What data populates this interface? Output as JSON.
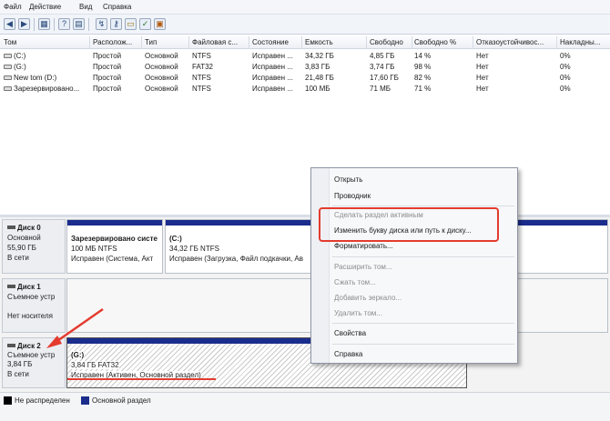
{
  "menu": [
    "Файл",
    "Действие",
    "Вид",
    "Справка"
  ],
  "toolbar_icons": [
    "back-icon",
    "forward-icon",
    "grid-icon",
    "help-icon",
    "properties-icon",
    "connect-icon",
    "key-icon",
    "folder-icon",
    "check-icon",
    "image-icon"
  ],
  "table": {
    "headers": [
      "Том",
      "Располож...",
      "Тип",
      "Файловая с...",
      "Состояние",
      "Емкость",
      "Свободно",
      "Свободно %",
      "Отказоустойчивос...",
      "Накладны..."
    ],
    "rows": [
      [
        "(C:)",
        "Простой",
        "Основной",
        "NTFS",
        "Исправен ...",
        "34,32 ГБ",
        "4,85 ГБ",
        "14 %",
        "Нет",
        "0%"
      ],
      [
        "(G:)",
        "Простой",
        "Основной",
        "FAT32",
        "Исправен ...",
        "3,83 ГБ",
        "3,74 ГБ",
        "98 %",
        "Нет",
        "0%"
      ],
      [
        "New tom (D:)",
        "Простой",
        "Основной",
        "NTFS",
        "Исправен ...",
        "21,48 ГБ",
        "17,60 ГБ",
        "82 %",
        "Нет",
        "0%"
      ],
      [
        "Зарезервировано...",
        "Простой",
        "Основной",
        "NTFS",
        "Исправен ...",
        "100 МБ",
        "71 МБ",
        "71 %",
        "Нет",
        "0%"
      ]
    ]
  },
  "disks": [
    {
      "name": "Диск 0",
      "type": "Основной",
      "size": "55,90 ГБ",
      "status": "В сети"
    },
    {
      "name": "Диск 1",
      "type": "Съемное устр",
      "size": "",
      "status": "Нет носителя"
    },
    {
      "name": "Диск 2",
      "type": "Съемное устр",
      "size": "3,84 ГБ",
      "status": "В сети"
    }
  ],
  "partitions": {
    "reserved": {
      "title": "Зарезервировано систе",
      "line2": "100 МБ NTFS",
      "line3": "Исправен (Система, Акт"
    },
    "c": {
      "title": "(C:)",
      "line2": "34,32 ГБ NTFS",
      "line3": "Исправен (Загрузка, Файл подкачки, Ав"
    },
    "g": {
      "title": "(G:)",
      "line2": "3,84 ГБ FAT32",
      "line3": "Исправен (Активен, Основной раздел)"
    }
  },
  "legend": [
    {
      "label": "Не распределен",
      "color": "#000000"
    },
    {
      "label": "Основной раздел",
      "color": "#1a2c8c"
    }
  ],
  "context_menu": {
    "items": [
      {
        "label": "Открыть",
        "enabled": true
      },
      {
        "label": "Проводник",
        "enabled": true
      },
      {
        "label": "Сделать раздел активным",
        "enabled": false
      },
      {
        "label": "Изменить букву диска или путь к диску...",
        "enabled": true
      },
      {
        "label": "Форматировать...",
        "enabled": true
      },
      {
        "label": "Расширить том...",
        "enabled": false
      },
      {
        "label": "Сжать том...",
        "enabled": false
      },
      {
        "label": "Добавить зеркало...",
        "enabled": false
      },
      {
        "label": "Удалить том...",
        "enabled": false
      },
      {
        "label": "Свойства",
        "enabled": true
      },
      {
        "label": "Справка",
        "enabled": true
      }
    ]
  },
  "colors": {
    "primary_partition": "#1a2c8c",
    "highlight": "#e43b2e"
  }
}
